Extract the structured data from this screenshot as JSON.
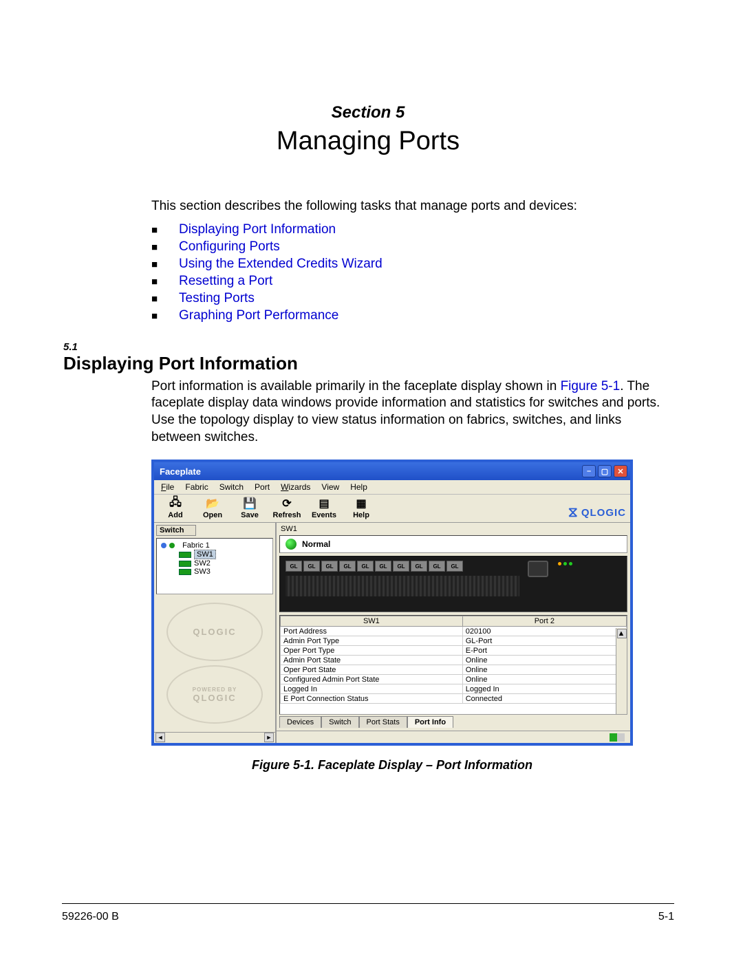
{
  "header": {
    "section_label": "Section 5",
    "title": "Managing Ports"
  },
  "intro": "This section describes the following tasks that manage ports and devices:",
  "toc": [
    "Displaying Port Information",
    "Configuring Ports",
    "Using the Extended Credits Wizard",
    "Resetting a Port",
    "Testing Ports",
    "Graphing Port Performance"
  ],
  "subsection": {
    "number": "5.1",
    "title": "Displaying Port Information",
    "text_before_link": "Port information is available primarily in the faceplate display shown in ",
    "figure_ref": "Figure 5-1",
    "text_after_link": ". The faceplate display data windows provide information and statistics for switches and ports. Use the topology display to view status information on fabrics, switches, and links between switches."
  },
  "app": {
    "window_title": "Faceplate",
    "menus": [
      "File",
      "Fabric",
      "Switch",
      "Port",
      "Wizards",
      "View",
      "Help"
    ],
    "toolbar": [
      "Add",
      "Open",
      "Save",
      "Refresh",
      "Events",
      "Help"
    ],
    "brand": "QLOGIC",
    "switch_button": "Switch",
    "tree": {
      "root": "Fabric 1",
      "items": [
        "SW1",
        "SW2",
        "SW3"
      ],
      "selected": "SW1"
    },
    "left_logo_top": "QLOGIC",
    "left_logo_bottom_small": "POWERED BY",
    "left_logo_bottom": "QLOGIC",
    "selected_switch": "SW1",
    "status": "Normal",
    "port_label": "GL",
    "table_headers": [
      "SW1",
      "Port 2"
    ],
    "rows": [
      [
        "Port Address",
        "020100"
      ],
      [
        "Admin Port Type",
        "GL-Port"
      ],
      [
        "Oper Port Type",
        "E-Port"
      ],
      [
        "Admin Port State",
        "Online"
      ],
      [
        "Oper Port State",
        "Online"
      ],
      [
        "Configured Admin Port State",
        "Online"
      ],
      [
        "Logged In",
        "Logged In"
      ],
      [
        "E Port Connection Status",
        "Connected"
      ]
    ],
    "tabs": [
      "Devices",
      "Switch",
      "Port Stats",
      "Port Info"
    ],
    "active_tab": "Port Info"
  },
  "figure_caption": "Figure 5-1.  Faceplate Display – Port Information",
  "footer": {
    "left": "59226-00 B",
    "right": "5-1"
  }
}
